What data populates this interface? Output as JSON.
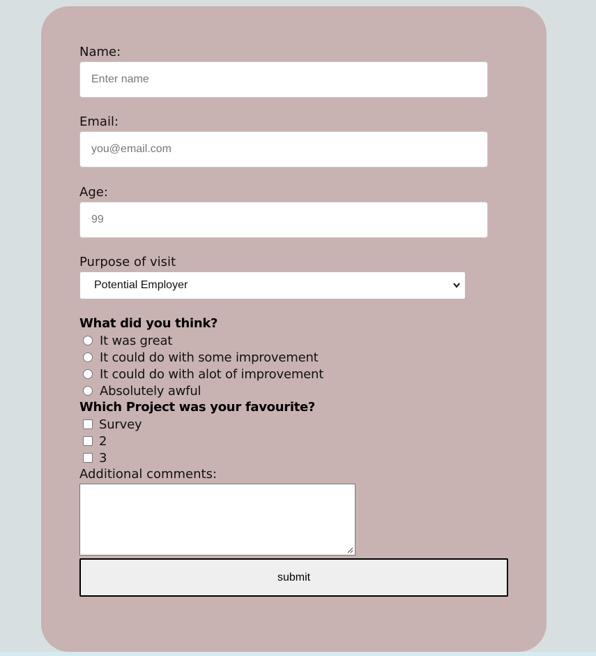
{
  "form": {
    "name": {
      "label": "Name:",
      "placeholder": "Enter name"
    },
    "email": {
      "label": "Email:",
      "placeholder": "you@email.com"
    },
    "age": {
      "label": "Age:",
      "placeholder": "99"
    },
    "purpose": {
      "label": "Purpose of visit",
      "selected": "Potential Employer"
    },
    "feedback": {
      "heading": "What did you think?",
      "options": [
        "It was great",
        "It could do with some improvement",
        "It could do with alot of improvement",
        "Absolutely awful"
      ]
    },
    "projects": {
      "heading": "Which Project was your favourite?",
      "options": [
        "Survey",
        "2",
        "3"
      ]
    },
    "comments": {
      "label": "Additional comments:"
    },
    "submit_label": "submit"
  },
  "colors": {
    "page_background": "#d8dfe0",
    "card_background": "#c9b2b2",
    "bottom_strip": "#d6ebf0"
  }
}
